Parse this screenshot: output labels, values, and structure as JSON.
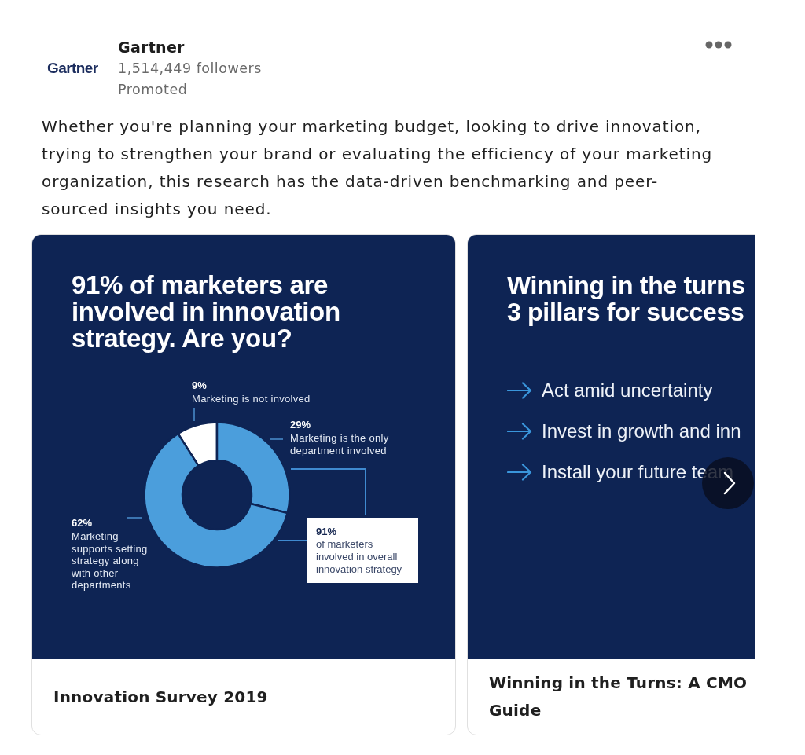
{
  "post": {
    "author": {
      "logo_text": "Gartner",
      "name": "Gartner",
      "followers": "1,514,449 followers",
      "label": "Promoted"
    },
    "text": "Whether you're planning your marketing budget, looking to drive innovation, trying to strengthen your brand or evaluating the efficiency of your marketing organization, this research has the data-driven benchmarking and peer-sourced insights you need."
  },
  "carousel": {
    "slides": [
      {
        "kind": "chart",
        "headline": "91% of marketers are involved in innovation strategy. Are you?",
        "chart_data": {
          "type": "donut",
          "categories": [
            "Marketing is not involved",
            "Marketing is the only department involved",
            "Marketing supports setting strategy along with other departments"
          ],
          "values": [
            9,
            29,
            62
          ],
          "value_labels": [
            "9%",
            "29%",
            "62%"
          ],
          "colors": [
            "#ffffff",
            "#4b9edc",
            "#4b9edc"
          ]
        },
        "callout": {
          "value": "91%",
          "text": "of marketers involved in overall innovation strategy"
        },
        "caption": "Innovation Survey 2019"
      },
      {
        "kind": "list",
        "headline": "Winning in the turns 3 pillars for success",
        "points": [
          "Act amid uncertainty",
          "Invest in growth and inn",
          "Install your future team"
        ],
        "caption": "Winning in the Turns: A CMO Guide"
      }
    ]
  }
}
